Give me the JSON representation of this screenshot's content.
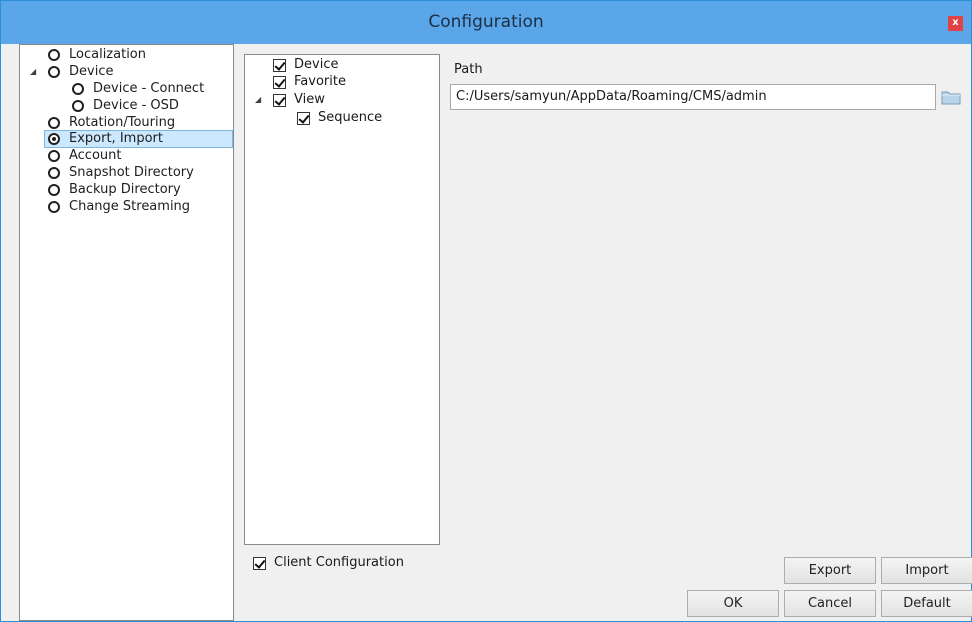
{
  "window": {
    "title": "Configuration",
    "close_label": "x"
  },
  "nav": {
    "items": [
      {
        "label": "Localization",
        "selected": false
      },
      {
        "label": "Device",
        "selected": false,
        "expanded": true
      },
      {
        "label": "Device - Connect",
        "selected": false
      },
      {
        "label": "Device - OSD",
        "selected": false
      },
      {
        "label": "Rotation/Touring",
        "selected": false
      },
      {
        "label": "Export, Import",
        "selected": true
      },
      {
        "label": "Account",
        "selected": false
      },
      {
        "label": "Snapshot Directory",
        "selected": false
      },
      {
        "label": "Backup Directory",
        "selected": false
      },
      {
        "label": "Change Streaming",
        "selected": false
      }
    ]
  },
  "export_tree": {
    "items": [
      {
        "label": "Device",
        "checked": true
      },
      {
        "label": "Favorite",
        "checked": true
      },
      {
        "label": "View",
        "checked": true,
        "expanded": true
      },
      {
        "label": "Sequence",
        "checked": true
      }
    ]
  },
  "client_config": {
    "label": "Client Configuration",
    "checked": true
  },
  "path": {
    "label": "Path",
    "value": "C:/Users/samyun/AppData/Roaming/CMS/admin"
  },
  "buttons": {
    "export": "Export",
    "import": "Import",
    "ok": "OK",
    "cancel": "Cancel",
    "default": "Default"
  },
  "icons": {
    "expander": "triangle-expanded-icon",
    "folder": "folder-icon",
    "close": "close-icon"
  }
}
